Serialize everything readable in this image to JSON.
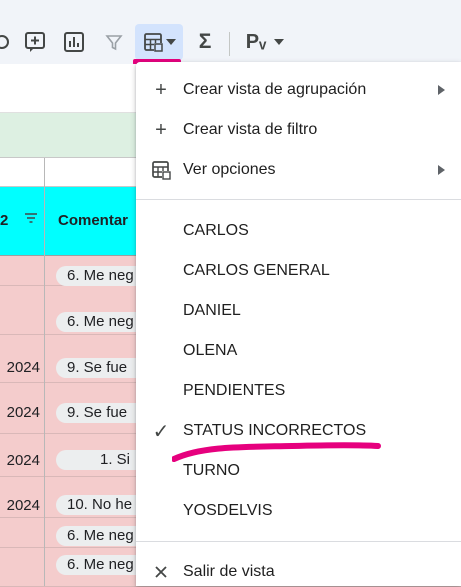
{
  "toolbar": {
    "items": [
      {
        "name": "link-icon"
      },
      {
        "name": "insert-comment-icon"
      },
      {
        "name": "insert-chart-icon"
      },
      {
        "name": "filter-icon"
      },
      {
        "name": "filter-views-icon"
      },
      {
        "name": "functions-icon",
        "glyph": "Σ"
      },
      {
        "name": "input-tools-icon",
        "glyph": "Pᵥ"
      }
    ],
    "highlight_color": "#e6007e"
  },
  "sheet": {
    "header_col_a": "2",
    "header_col_b": "Comentar",
    "header_fill": "#00ffff",
    "row_fill": "#f4cccc",
    "rows": [
      {
        "date": "",
        "comment": "6. Me neg"
      },
      {
        "date": "",
        "comment": "6. Me neg"
      },
      {
        "date": "2024",
        "comment": "9. Se fue"
      },
      {
        "date": "2024",
        "comment": "9. Se fue"
      },
      {
        "date": "2024",
        "comment": "1. Si"
      },
      {
        "date": "2024",
        "comment": "10. No he"
      },
      {
        "date": "",
        "comment": "6. Me neg"
      },
      {
        "date": "",
        "comment": "6. Me neg"
      }
    ]
  },
  "menu": {
    "actions": [
      {
        "label": "Crear vista de agrupación",
        "icon": "plus-icon",
        "submenu": true
      },
      {
        "label": "Crear vista de filtro",
        "icon": "plus-icon",
        "submenu": false
      },
      {
        "label": "Ver opciones",
        "icon": "filter-views-icon",
        "submenu": true
      }
    ],
    "views": [
      {
        "label": "CARLOS",
        "checked": false
      },
      {
        "label": "CARLOS GENERAL",
        "checked": false
      },
      {
        "label": "DANIEL",
        "checked": false
      },
      {
        "label": "OLENA",
        "checked": false
      },
      {
        "label": "PENDIENTES",
        "checked": false
      },
      {
        "label": "STATUS INCORRECTOS",
        "checked": true
      },
      {
        "label": "TURNO",
        "checked": false
      },
      {
        "label": "YOSDELVIS",
        "checked": false
      }
    ],
    "exit": {
      "label": "Salir de vista",
      "icon": "close-icon"
    },
    "check_glyph": "✓"
  }
}
